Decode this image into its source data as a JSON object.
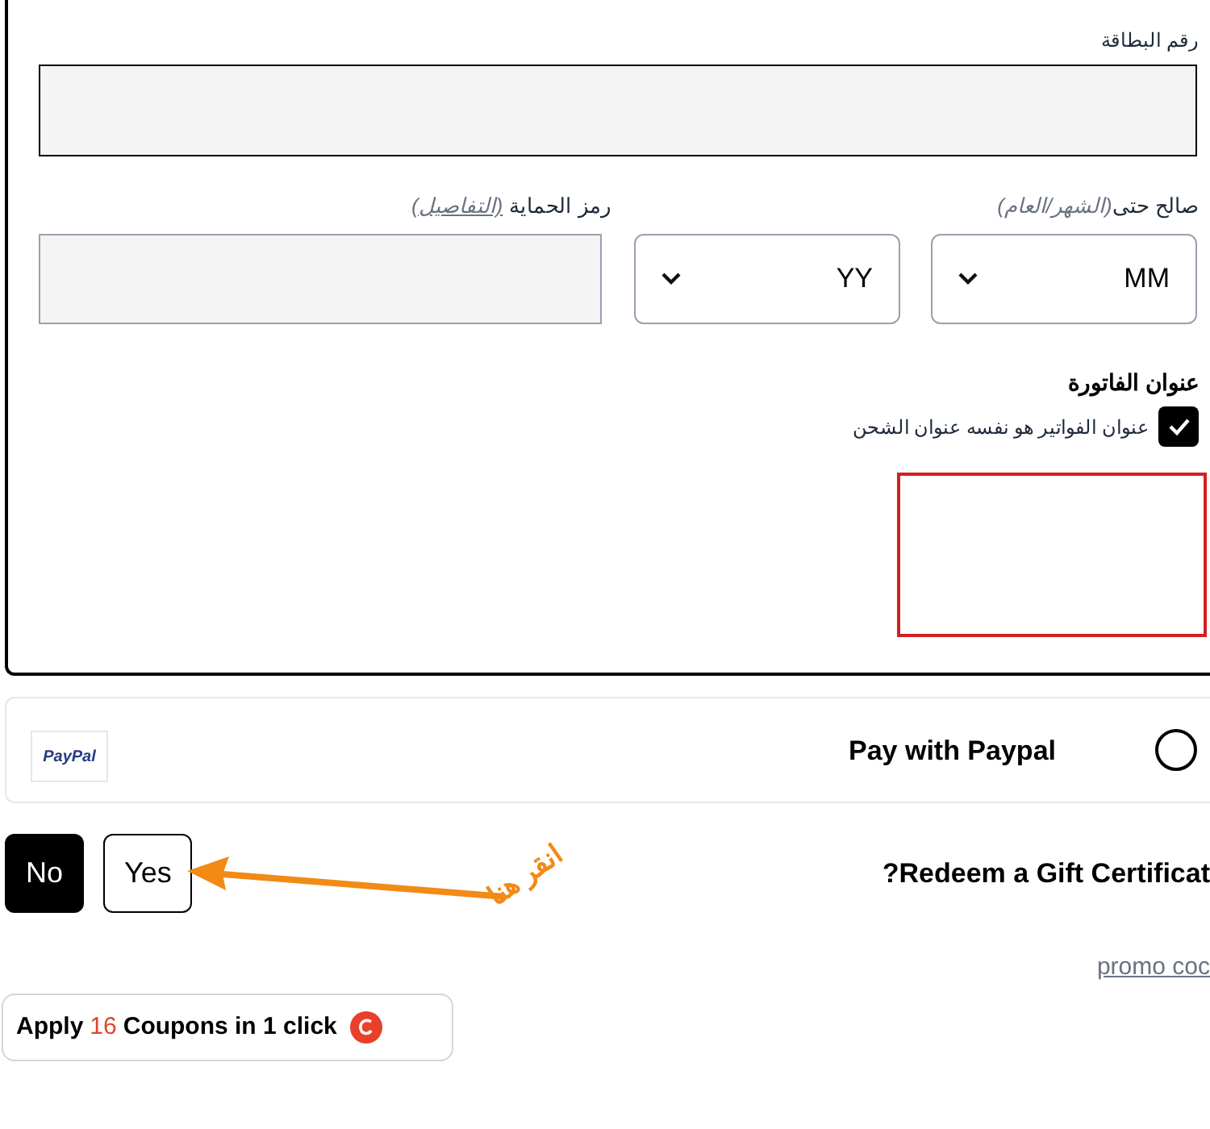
{
  "card_number": {
    "label": "رقم البطاقة"
  },
  "expiry": {
    "label": "صالح حتى",
    "format_hint": "(الشهر/العام)",
    "month": {
      "value": "MM"
    },
    "year": {
      "value": "YY"
    }
  },
  "cvv": {
    "label": "رمز الحماية",
    "details_link": "(التفاصيل)"
  },
  "billing": {
    "title": "عنوان الفاتورة",
    "same_as_shipping": {
      "label": "عنوان الفواتير هو نفسه عنوان الشحن",
      "checked": true
    }
  },
  "paypal": {
    "label": "Pay with Paypal",
    "selected": false,
    "logo": "PayPal"
  },
  "gift_certificate": {
    "question": "?Redeem a Gift Certificat",
    "options": [
      {
        "label": "Yes",
        "selected": false
      },
      {
        "label": "No",
        "selected": true
      }
    ]
  },
  "promo_link": "promo coc",
  "coupon_button": {
    "prefix": "Apply",
    "count": "16",
    "suffix": "Coupons in 1 click"
  },
  "annotation": {
    "text": "انقر هنا"
  }
}
